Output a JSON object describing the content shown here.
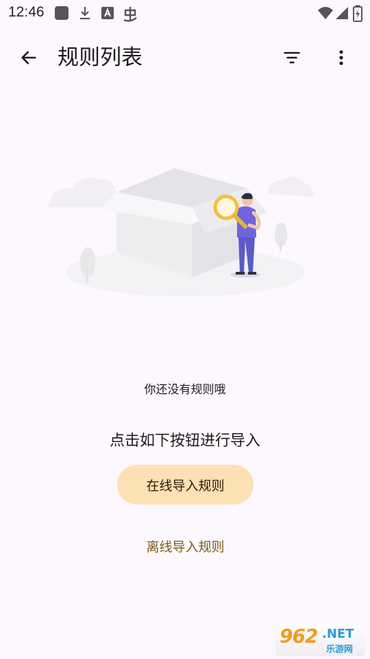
{
  "status_bar": {
    "time": "12:46",
    "icons": [
      "app-notification-icon",
      "download-icon",
      "font-a-icon",
      "bug-icon",
      "wifi-icon",
      "signal-icon",
      "battery-charging-icon"
    ]
  },
  "app_bar": {
    "title": "规则列表",
    "back_icon": "arrow-back-icon",
    "filter_icon": "filter-icon",
    "more_icon": "more-vert-icon"
  },
  "empty_state": {
    "message": "你还没有规则哦",
    "hint": "点击如下按钮进行导入"
  },
  "actions": {
    "online_import_label": "在线导入规则",
    "offline_import_label": "离线导入规则"
  },
  "watermark": {
    "number": "962",
    "domain": ".NET",
    "subtitle": "乐游网"
  },
  "colors": {
    "background": "#fdf8fd",
    "primary_button": "#fde0b4",
    "secondary_text": "#7a5a17",
    "figure_shirt": "#6f63e0",
    "magnifier": "#f3c13a"
  }
}
